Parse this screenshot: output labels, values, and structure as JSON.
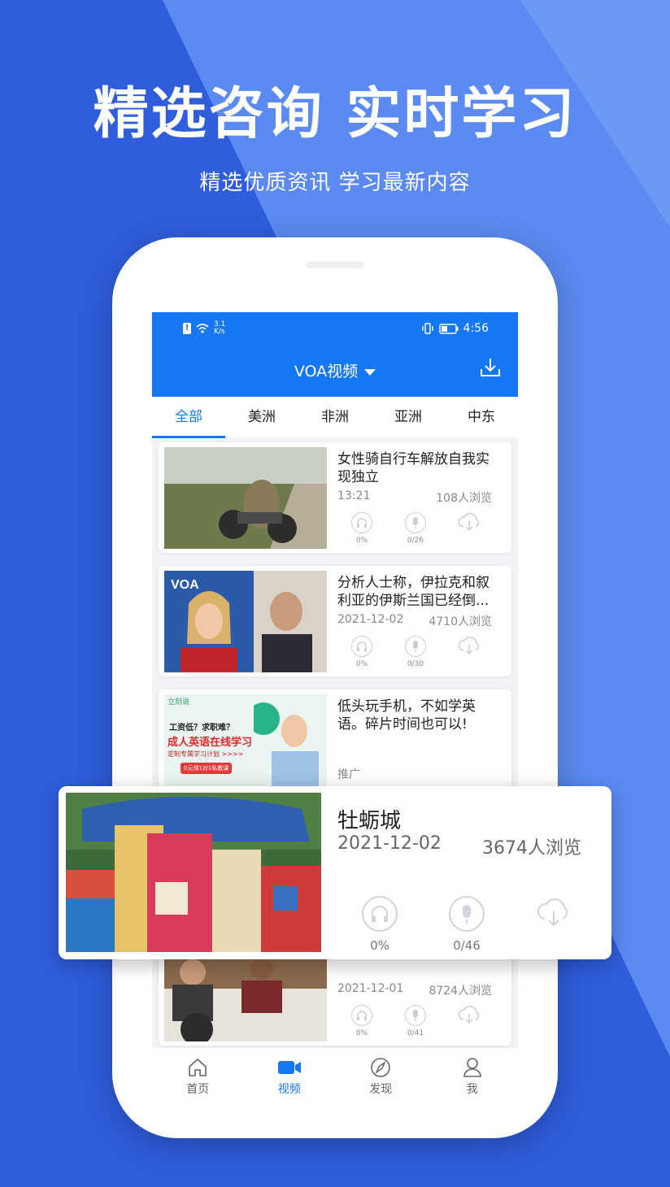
{
  "promo": {
    "headline": "精选咨询 实时学习",
    "subline": "精选优质资讯 学习最新内容"
  },
  "statusbar": {
    "speed_value": "3.1",
    "speed_unit": "K/s",
    "time": "4:56"
  },
  "navbar": {
    "title": "VOA视频"
  },
  "tabs": [
    "全部",
    "美洲",
    "非洲",
    "亚洲",
    "中东"
  ],
  "active_tab": 0,
  "videos": [
    {
      "title": "女性骑自行车解放自我实现独立",
      "date": "13:21",
      "views": "108人浏览",
      "listen": "0%",
      "record": "0/26"
    },
    {
      "title": "分析人士称，伊拉克和叙利亚的伊斯兰国已经倒...",
      "date": "2021-12-02",
      "views": "4710人浏览",
      "listen": "0%",
      "record": "0/30"
    },
    {
      "title": "低头玩手机，不如学英语。碎片时间也可以!",
      "tag": "推广",
      "ad_brand": "立刻说",
      "ad_line1": "工资低？求职难？",
      "ad_line2": "成人英语在线学习",
      "ad_line3": "定制专属学习计划 >>>>",
      "ad_btn": "0元领1对1私教课"
    },
    {
      "title": "",
      "date": "2021-12-01",
      "views": "8724人浏览",
      "listen": "0%",
      "record": "0/41"
    }
  ],
  "featured": {
    "title": "牡蛎城",
    "date": "2021-12-02",
    "views": "3674人浏览",
    "listen": "0%",
    "record": "0/46"
  },
  "bottom_nav": [
    "首页",
    "视频",
    "发现",
    "我"
  ],
  "active_nav": 1,
  "colors": {
    "accent": "#1677f2",
    "background": "#3f6fe6"
  }
}
